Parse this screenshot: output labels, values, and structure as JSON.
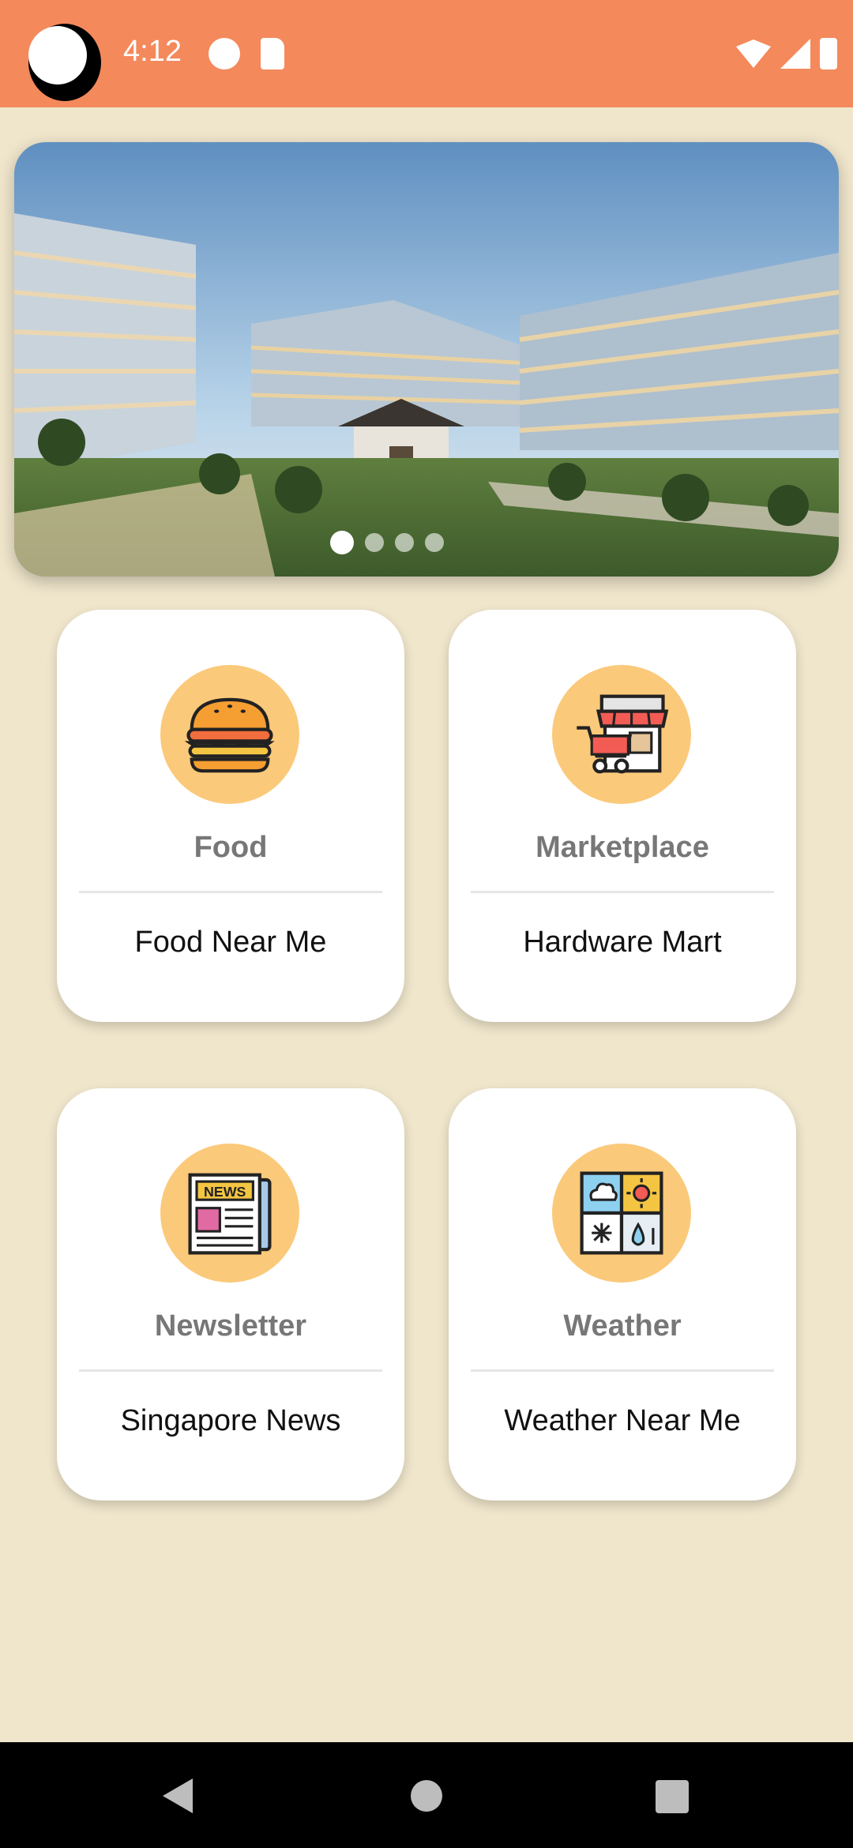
{
  "status_bar": {
    "time": "4:12",
    "icons": [
      "camera-cutout",
      "media-icon",
      "sd-card-icon",
      "wifi-icon",
      "signal-icon",
      "battery-icon"
    ]
  },
  "carousel": {
    "image": "campus-buildings-photo",
    "page_count": 4,
    "active_index": 0
  },
  "cards": [
    {
      "id": "food",
      "icon": "burger-icon",
      "title": "Food",
      "subtitle": "Food Near Me"
    },
    {
      "id": "market",
      "icon": "market-stall-icon",
      "title": "Marketplace",
      "subtitle": "Hardware Mart"
    },
    {
      "id": "news",
      "icon": "newspaper-icon",
      "title": "Newsletter",
      "subtitle": "Singapore News"
    },
    {
      "id": "weather",
      "icon": "weather-grid-icon",
      "title": "Weather",
      "subtitle": "Weather Near Me"
    }
  ],
  "nav_bar": {
    "buttons": [
      "back-icon",
      "home-icon",
      "recents-icon"
    ]
  },
  "colors": {
    "status_bar": "#f4895c",
    "background": "#f0e6cc",
    "icon_circle": "#fbc97a"
  }
}
